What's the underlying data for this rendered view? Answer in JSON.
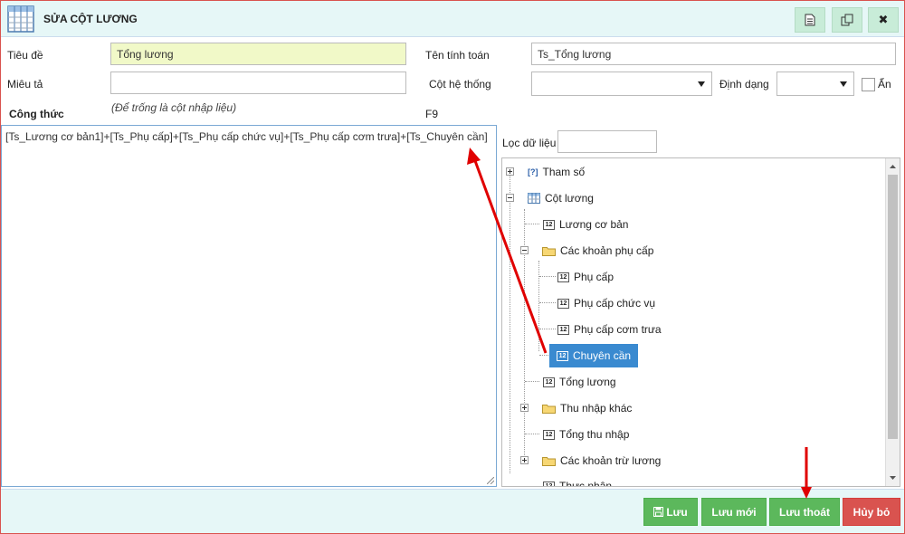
{
  "dialog": {
    "title": "SỬA CỘT LƯƠNG"
  },
  "toolbar": {
    "icons": [
      "document-icon",
      "copy-icon",
      "close-icon"
    ],
    "close_glyph": "✖"
  },
  "form": {
    "tieu_de_label": "Tiêu đề",
    "tieu_de_value": "Tổng lương",
    "ten_tinh_toan_label": "Tên tính toán",
    "ten_tinh_toan_value": "Ts_Tổng lương",
    "mieu_ta_label": "Miêu tả",
    "mieu_ta_value": "",
    "cot_he_thong_label": "Cột hệ thống",
    "cot_he_thong_value": "",
    "dinh_dang_label": "Định dạng",
    "dinh_dang_value": "",
    "an_label": "Ẩn",
    "cong_thuc_label": "Công thức",
    "cong_thuc_hint": "(Để trống là cột nhập liệu)",
    "f9_label": "F9",
    "formula": "[Ts_Lương cơ bản1]+[Ts_Phụ cấp]+[Ts_Phụ cấp chức vụ]+[Ts_Phụ cấp cơm trưa]+[Ts_Chuyên cần]"
  },
  "filter": {
    "label": "Lọc dữ liệu",
    "value": ""
  },
  "tree": {
    "tham_so": "Tham số",
    "cot_luong": "Cột lương",
    "luong_co_ban": "Lương cơ bản",
    "cac_khoan_phu_cap": "Các khoản phụ cấp",
    "phu_cap": "Phụ cấp",
    "phu_cap_chuc_vu": "Phụ cấp chức vụ",
    "phu_cap_com_trua": "Phụ cấp cơm trưa",
    "chuyen_can": "Chuyên cần",
    "tong_luong": "Tổng lương",
    "thu_nhap_khac": "Thu nhập khác",
    "tong_thu_nhap": "Tổng thu nhập",
    "cac_khoan_tru_luong": "Các khoản trừ lương",
    "thuc_nhan": "Thực nhận",
    "num_icon_text": "12",
    "param_icon_text": "[?]"
  },
  "footer": {
    "luu": "Lưu",
    "luu_moi": "Lưu mới",
    "luu_thoat": "Lưu thoát",
    "huy_bo": "Hủy bỏ"
  },
  "colors": {
    "green": "#5cb85c",
    "red": "#d9534f",
    "selected": "#3a8ad0",
    "annotation_arrow": "#e00000"
  }
}
